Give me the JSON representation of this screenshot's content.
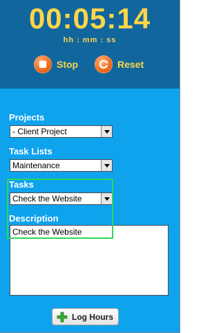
{
  "timer": {
    "value": "00:05:14",
    "format": "hh : mm : ss"
  },
  "controls": {
    "stop_label": "Stop",
    "reset_label": "Reset"
  },
  "form": {
    "projects": {
      "label": "Projects",
      "selected": "- Client Project"
    },
    "task_lists": {
      "label": "Task Lists",
      "selected": "Maintenance"
    },
    "tasks": {
      "label": "Tasks",
      "selected": "Check the Website"
    },
    "description": {
      "label": "Description",
      "value": "Check the Website"
    }
  },
  "actions": {
    "log_hours_label": "Log Hours"
  },
  "colors": {
    "header_bg": "#11679d",
    "panel_bg": "#0fa3ee",
    "timer_text": "#ffd54a",
    "highlight": "#2fd65a",
    "icon_orange": "#f26a1a",
    "plus_green": "#3aa832"
  }
}
